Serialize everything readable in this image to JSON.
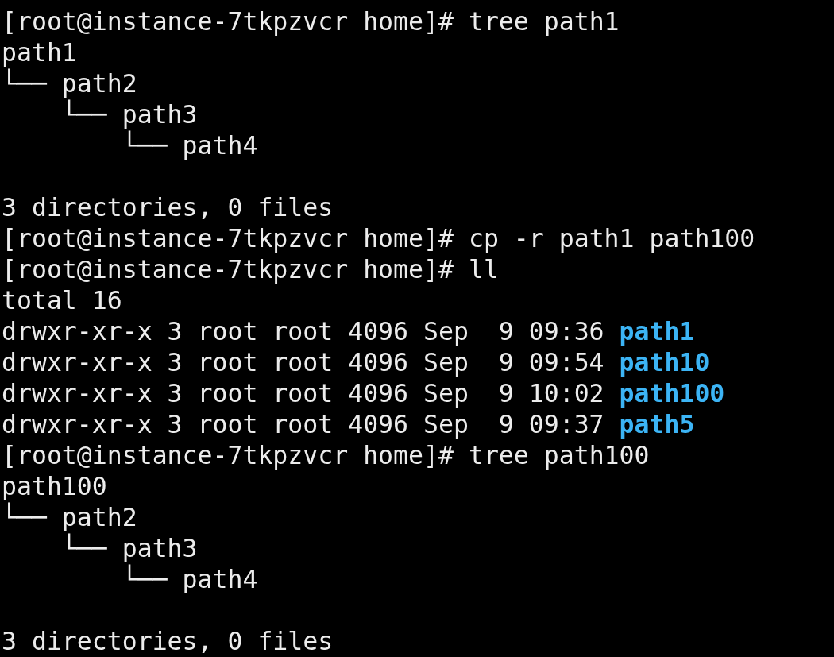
{
  "terminal": {
    "blocks": [
      {
        "kind": "command",
        "prompt": "[root@instance-7tkpzvcr home]#",
        "command": "tree path1"
      },
      {
        "kind": "tree",
        "root": "path1",
        "children": [
          {
            "branch": "└──",
            "name": "path2",
            "children": [
              {
                "branch": "└──",
                "name": "path3",
                "children": [
                  {
                    "branch": "└──",
                    "name": "path4"
                  }
                ]
              }
            ]
          }
        ]
      },
      {
        "kind": "blank"
      },
      {
        "kind": "output",
        "text": "3 directories, 0 files"
      },
      {
        "kind": "command",
        "prompt": "[root@instance-7tkpzvcr home]#",
        "command": "cp -r path1 path100"
      },
      {
        "kind": "command",
        "prompt": "[root@instance-7tkpzvcr home]#",
        "command": "ll"
      },
      {
        "kind": "output",
        "text": "total 16"
      },
      {
        "kind": "listing",
        "rows": [
          {
            "info": "drwxr-xr-x 3 root root 4096 Sep  9 09:36",
            "name": "path1"
          },
          {
            "info": "drwxr-xr-x 3 root root 4096 Sep  9 09:54",
            "name": "path10"
          },
          {
            "info": "drwxr-xr-x 3 root root 4096 Sep  9 10:02",
            "name": "path100"
          },
          {
            "info": "drwxr-xr-x 3 root root 4096 Sep  9 09:37",
            "name": "path5"
          }
        ]
      },
      {
        "kind": "command",
        "prompt": "[root@instance-7tkpzvcr home]#",
        "command": "tree path100"
      },
      {
        "kind": "tree",
        "root": "path100",
        "children": [
          {
            "branch": "└──",
            "name": "path2",
            "children": [
              {
                "branch": "└──",
                "name": "path3",
                "children": [
                  {
                    "branch": "└──",
                    "name": "path4"
                  }
                ]
              }
            ]
          }
        ]
      },
      {
        "kind": "blank"
      },
      {
        "kind": "output",
        "text": "3 directories, 0 files"
      }
    ]
  }
}
